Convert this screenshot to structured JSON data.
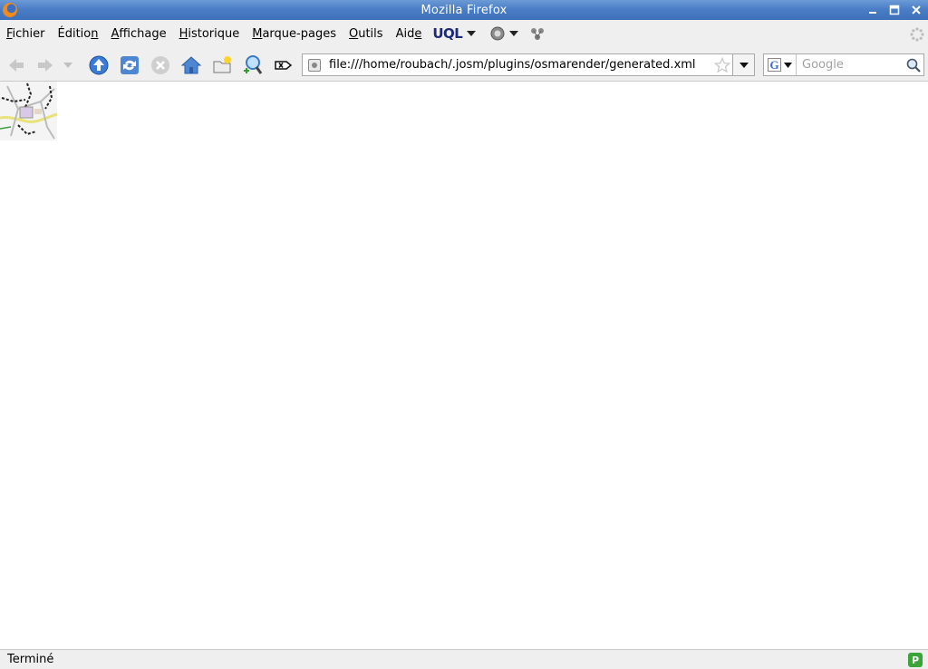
{
  "window": {
    "title": "Mozilla Firefox"
  },
  "menu": {
    "items": [
      {
        "label": "Fichier",
        "accel": "F"
      },
      {
        "label": "Édition",
        "accel": "n"
      },
      {
        "label": "Affichage",
        "accel": "A"
      },
      {
        "label": "Historique",
        "accel": "H"
      },
      {
        "label": "Marque-pages",
        "accel": "M"
      },
      {
        "label": "Outils",
        "accel": "O"
      },
      {
        "label": "Aide",
        "accel": "e"
      }
    ],
    "uql_label": "UQL"
  },
  "toolbar": {
    "icons": [
      "back-icon",
      "forward-icon",
      "history-dropdown-icon",
      "upload-icon",
      "reload-icon",
      "stop-icon",
      "home-icon",
      "new-bookmark-icon",
      "zoom-search-icon",
      "clear-icon"
    ]
  },
  "urlbar": {
    "value": "file:///home/roubach/.josm/plugins/osmarender/generated.xml"
  },
  "search": {
    "placeholder": "Google",
    "engine": "G"
  },
  "status": {
    "text": "Terminé",
    "badge": "P"
  },
  "colors": {
    "titlebar": "#4a7ec6",
    "chrome": "#efefef",
    "uql": "#1c2a7a"
  }
}
